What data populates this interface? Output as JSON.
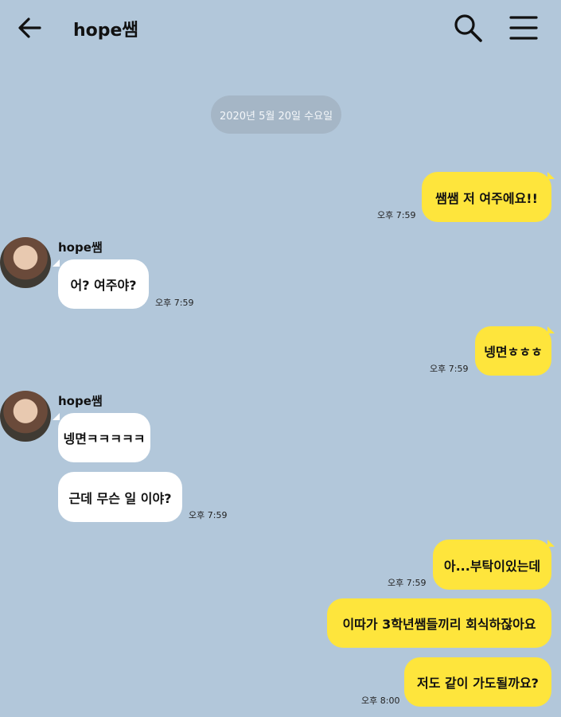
{
  "header": {
    "back_icon": "arrow-left-icon",
    "title": "hope쌤",
    "search_icon": "search-icon",
    "menu_icon": "menu-icon"
  },
  "date_divider": "2020년 5월 20일 수요일",
  "sender_name": "hope쌤",
  "messages": [
    {
      "from": "me",
      "text": "쌤쌤 저 여주에요!!",
      "time": "오후 7:59"
    },
    {
      "from": "them",
      "text": "어? 여주야?",
      "time": "오후 7:59"
    },
    {
      "from": "me",
      "text": "넹면ㅎㅎㅎ",
      "time": "오후 7:59"
    },
    {
      "from": "them",
      "text": "넹면ㅋㅋㅋㅋㅋ",
      "time": ""
    },
    {
      "from": "them",
      "text": "근데 무슨 일 이야?",
      "time": "오후 7:59"
    },
    {
      "from": "me",
      "text": "아...부탁이있는데",
      "time": "오후 7:59"
    },
    {
      "from": "me",
      "text": "이따가 3학년쌤들끼리 회식하잖아요",
      "time": ""
    },
    {
      "from": "me",
      "text": "저도 같이 가도될까요?",
      "time": "오후 8:00"
    }
  ],
  "colors": {
    "background": "#b2c7da",
    "my_bubble": "#fee53c",
    "their_bubble": "#ffffff",
    "date_pill": "#a5b6c6"
  }
}
